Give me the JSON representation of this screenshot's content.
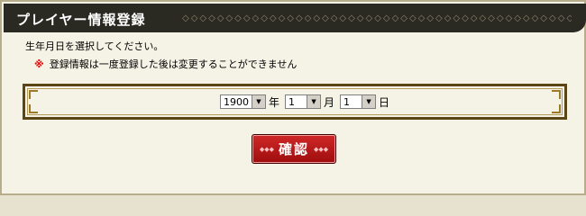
{
  "header": {
    "title": "プレイヤー情報登録",
    "ornament": "◇◇◇◇◇◇◇◇◇◇◇◇◇◇◇◇◇◇◇◇◇◇◇◇◇◇◇◇◇◇◇◇◇◇◇◇◇◇◇◇◇◇◇◇◇◇◇◇◇◇"
  },
  "form": {
    "instruction": "生年月日を選択してください。",
    "note_mark": "※",
    "note_text": "登録情報は一度登録した後は変更することができません",
    "year": {
      "value": "1900",
      "unit": "年"
    },
    "month": {
      "value": "1",
      "unit": "月"
    },
    "day": {
      "value": "1",
      "unit": "日"
    },
    "dropdown_glyph": "▼",
    "confirm_label": "確認",
    "confirm_ornament": "◆◆◆"
  },
  "colors": {
    "accent_red": "#c01818",
    "frame_brown": "#5b4514"
  }
}
